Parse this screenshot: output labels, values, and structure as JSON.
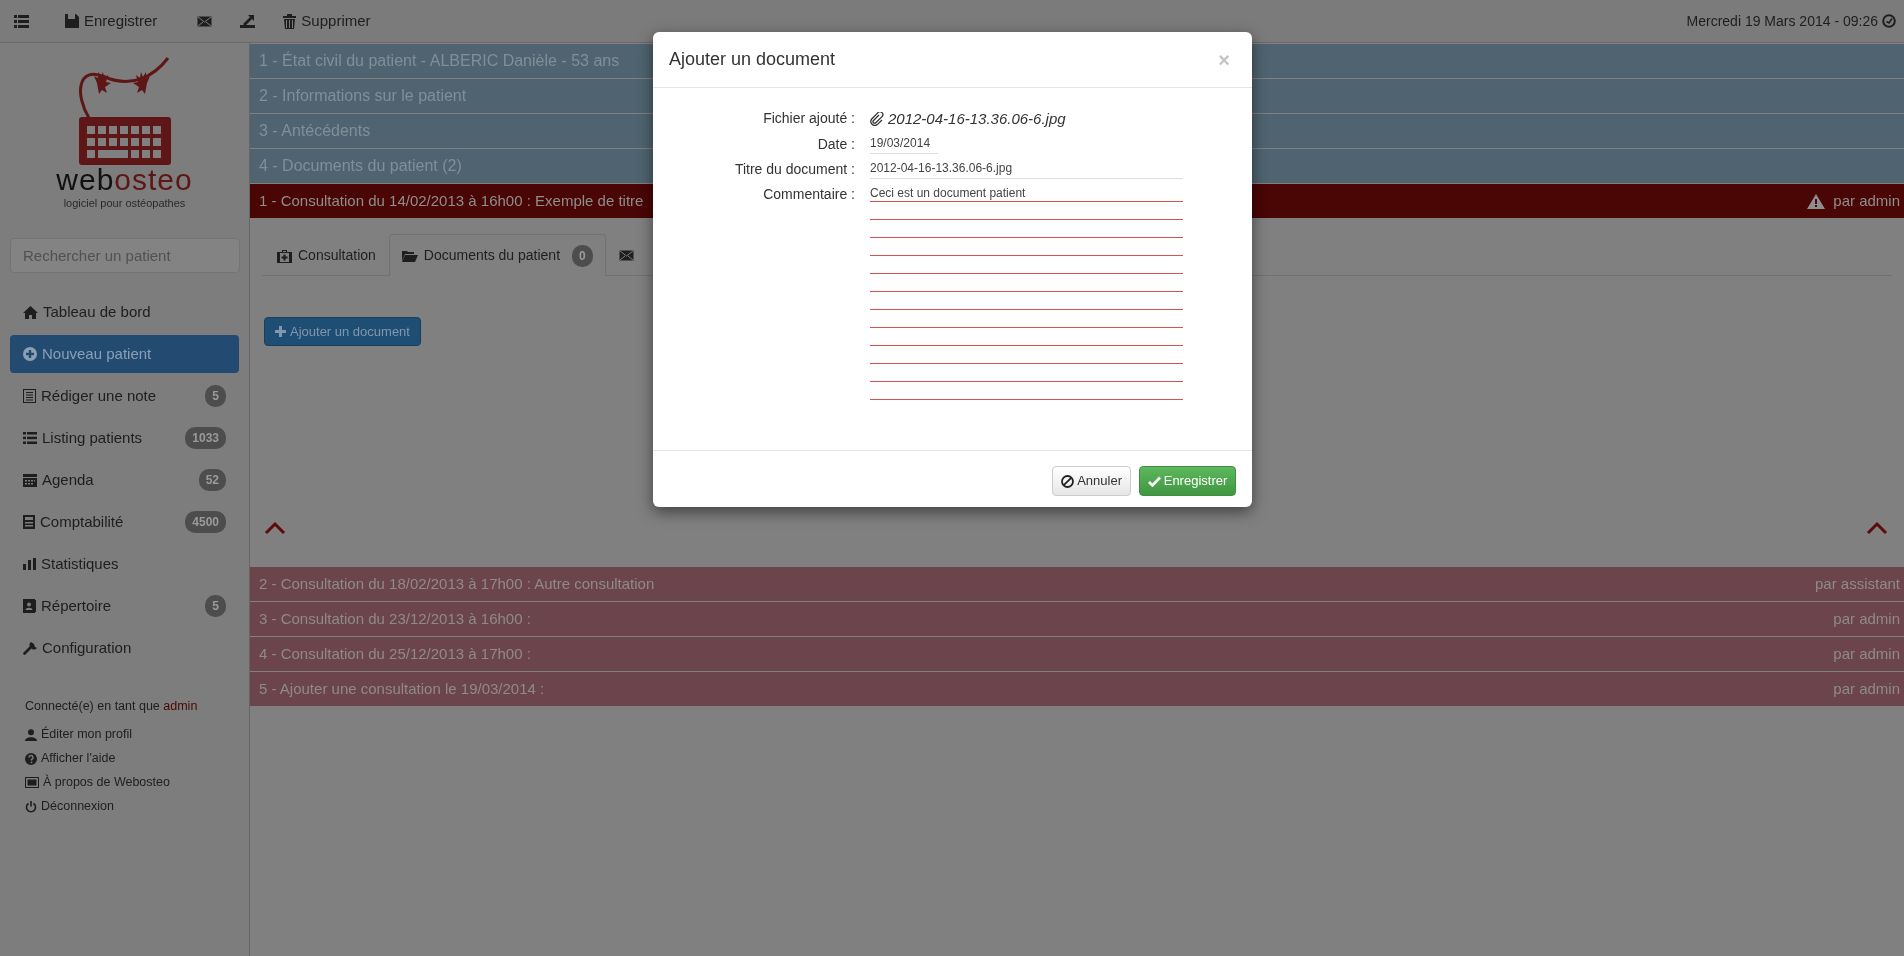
{
  "toolbar": {
    "save": "Enregistrer",
    "delete": "Supprimer",
    "datetime": "Mercredi 19 Mars 2014 - 09:26"
  },
  "sidebar": {
    "logo": {
      "wordmark": [
        "web",
        "osteo"
      ],
      "tagline": "logiciel pour ostéopathes"
    },
    "search": {
      "placeholder": "Rechercher un patient"
    },
    "nav": [
      {
        "label": "Tableau de bord",
        "selected": false
      },
      {
        "label": "Nouveau patient",
        "selected": true
      },
      {
        "label": "Rédiger une note",
        "badge": "5",
        "selected": false
      },
      {
        "label": "Listing patients",
        "badge": "1033",
        "selected": false
      },
      {
        "label": "Agenda",
        "badge": "52",
        "selected": false
      },
      {
        "label": "Comptabilité",
        "badge": "4500",
        "selected": false
      },
      {
        "label": "Statistiques",
        "selected": false
      },
      {
        "label": "Répertoire",
        "badge": "5",
        "selected": false
      },
      {
        "label": "Configuration",
        "selected": false
      }
    ],
    "connected": {
      "text": "Connecté(e) en tant que",
      "user": "admin"
    },
    "links": [
      "Éditer mon profil",
      "Afficher l'aide",
      "À propos de Webosteo",
      "Déconnexion"
    ]
  },
  "sections": [
    "1 - État civil du patient - ALBERIC Danièle - 53 ans",
    "2 - Informations sur le patient",
    "3 - Antécédents",
    "4 - Documents du patient (2)"
  ],
  "consultations": [
    {
      "label": "1 - Consultation du 14/02/2013 à 16h00 : Exemple de titre",
      "author": "par admin",
      "expanded": true
    },
    {
      "label": "2 - Consultation du 18/02/2013 à 17h00 : Autre consultation",
      "author": "par assistant",
      "expanded": false
    },
    {
      "label": "3 - Consultation du 23/12/2013 à 16h00 :",
      "author": "par admin",
      "expanded": false
    },
    {
      "label": "4 - Consultation du 25/12/2013 à 17h00 :",
      "author": "par admin",
      "expanded": false
    },
    {
      "label": "5 - Ajouter une consultation le 19/03/2014 :",
      "author": "par admin",
      "expanded": false
    }
  ],
  "tabs": [
    {
      "label": "Consultation",
      "selected": false
    },
    {
      "label": "Documents du patient",
      "badge": "0",
      "selected": true
    },
    {
      "selected": false
    }
  ],
  "add_button": "Ajouter un document",
  "modal": {
    "title": "Ajouter un document",
    "close": "×",
    "file_label": "Fichier ajouté :",
    "file_name": "2012-04-16-13.36.06-6.jpg",
    "date_label": "Date :",
    "date": "19/03/2014",
    "title_label": "Titre du document :",
    "doc_title": "2012-04-16-13.36.06-6.jpg",
    "comment_label": "Commentaire :",
    "comment": "Ceci est un document patient",
    "cancel": "Annuler",
    "save": "Enregistrer"
  }
}
